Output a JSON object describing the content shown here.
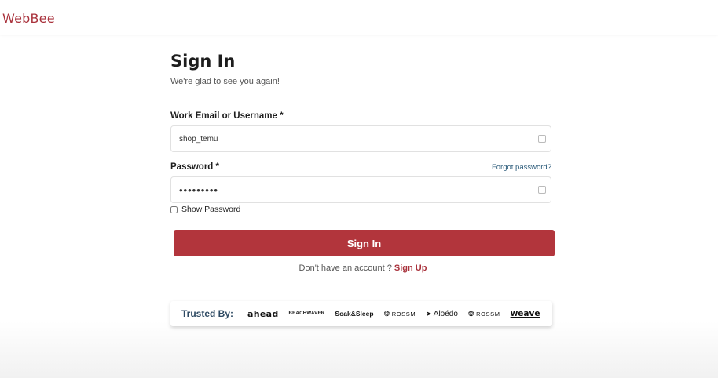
{
  "header": {
    "logo_text": "WebBee"
  },
  "signin": {
    "title": "Sign In",
    "subtitle": "We're glad to see you again!",
    "email_label": "Work Email or Username",
    "required_mark": "*",
    "email_value": "shop_temu",
    "password_label": "Password",
    "forgot_password": "Forgot password?",
    "password_value": "•••••••••",
    "show_password_label": "Show Password",
    "submit_label": "Sign In",
    "no_account_text": "Don't have an account ?",
    "signup_link": "Sign Up"
  },
  "trusted": {
    "label": "Trusted By:",
    "brands": [
      "ahead",
      "BEACHWAVER",
      "Soak&Sleep",
      "ROSSM",
      "Aloédo",
      "ROSSM",
      "weave"
    ]
  },
  "colors": {
    "accent": "#b2353c",
    "logo": "#a9323c",
    "link": "#2b5b7a"
  }
}
